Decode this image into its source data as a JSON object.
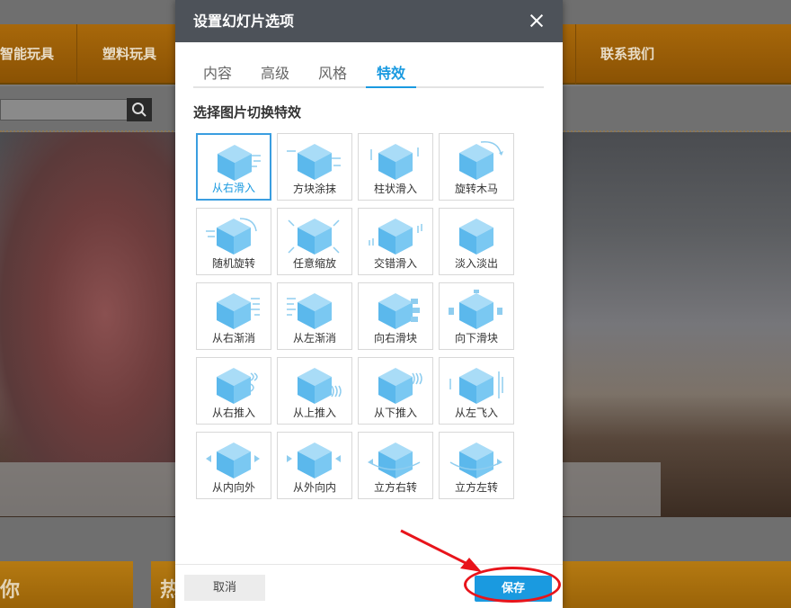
{
  "background_site": {
    "nav_items": [
      "智能玩具",
      "塑料玩具",
      "联系我们"
    ],
    "bottom_texts": [
      "你",
      "热"
    ]
  },
  "modal": {
    "title": "设置幻灯片选项",
    "tabs": [
      {
        "label": "内容",
        "active": false
      },
      {
        "label": "高级",
        "active": false
      },
      {
        "label": "风格",
        "active": false
      },
      {
        "label": "特效",
        "active": true
      }
    ],
    "section_label": "选择图片切换特效",
    "effects": [
      {
        "label": "从右滑入",
        "selected": true
      },
      {
        "label": "方块涂抹",
        "selected": false
      },
      {
        "label": "柱状滑入",
        "selected": false
      },
      {
        "label": "旋转木马",
        "selected": false
      },
      {
        "label": "随机旋转",
        "selected": false
      },
      {
        "label": "任意缩放",
        "selected": false
      },
      {
        "label": "交错滑入",
        "selected": false
      },
      {
        "label": "淡入淡出",
        "selected": false
      },
      {
        "label": "从右渐消",
        "selected": false
      },
      {
        "label": "从左渐消",
        "selected": false
      },
      {
        "label": "向右滑块",
        "selected": false
      },
      {
        "label": "向下滑块",
        "selected": false
      },
      {
        "label": "从右推入",
        "selected": false
      },
      {
        "label": "从上推入",
        "selected": false
      },
      {
        "label": "从下推入",
        "selected": false
      },
      {
        "label": "从左飞入",
        "selected": false
      },
      {
        "label": "从内向外",
        "selected": false
      },
      {
        "label": "从外向内",
        "selected": false
      },
      {
        "label": "立方右转",
        "selected": false
      },
      {
        "label": "立方左转",
        "selected": false
      }
    ],
    "footer": {
      "cancel_label": "取消",
      "save_label": "保存"
    }
  },
  "colors": {
    "accent": "#1a9ae0",
    "header_bg": "#4d5259",
    "annotation_red": "#e8141b",
    "cube_blue": "#6cc4f2"
  },
  "icons": {
    "close": "close-icon",
    "search": "search-icon",
    "effect": "cube-icon"
  }
}
